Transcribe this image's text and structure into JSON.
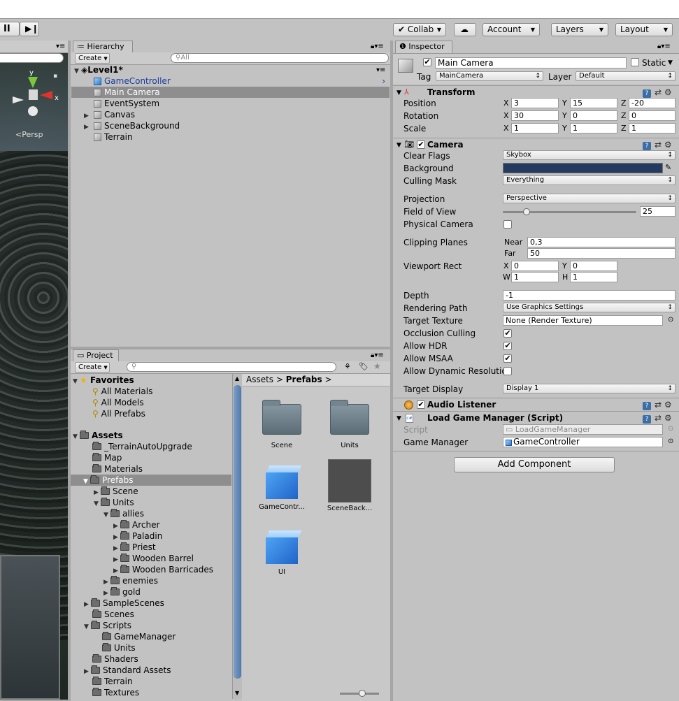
{
  "toolbar": {
    "collab": "Collab",
    "account": "Account",
    "layers": "Layers",
    "layout": "Layout"
  },
  "scene": {
    "persp_label": "<Persp",
    "gizmo_y": "y",
    "gizmo_x": "x"
  },
  "hierarchy": {
    "tab": "Hierarchy",
    "create": "Create",
    "search_placeholder": "All",
    "scene_name": "Level1*",
    "items": [
      {
        "label": "GameController"
      },
      {
        "label": "Main Camera"
      },
      {
        "label": "EventSystem"
      },
      {
        "label": "Canvas"
      },
      {
        "label": "SceneBackground"
      },
      {
        "label": "Terrain"
      }
    ]
  },
  "project": {
    "tab": "Project",
    "create": "Create",
    "favorites": {
      "label": "Favorites",
      "items": [
        "All Materials",
        "All Models",
        "All Prefabs"
      ]
    },
    "assets_label": "Assets",
    "tree": [
      "_TerrainAutoUpgrade",
      "Map",
      "Materials",
      "Prefabs",
      "Scene",
      "Units",
      "allies",
      "Archer",
      "Paladin",
      "Priest",
      "Wooden Barrel",
      "Wooden Barricades",
      "enemies",
      "gold",
      "SampleScenes",
      "Scenes",
      "Scripts",
      "GameManager",
      "Units",
      "Shaders",
      "Standard Assets",
      "Terrain",
      "Textures"
    ],
    "breadcrumb": [
      "Assets",
      "Prefabs"
    ],
    "grid": [
      "Scene",
      "Units",
      "GameContr...",
      "SceneBack...",
      "UI"
    ]
  },
  "inspector": {
    "tab": "Inspector",
    "object_name": "Main Camera",
    "static_label": "Static",
    "tag_label": "Tag",
    "tag_value": "MainCamera",
    "layer_label": "Layer",
    "layer_value": "Default",
    "transform": {
      "title": "Transform",
      "position_label": "Position",
      "rotation_label": "Rotation",
      "scale_label": "Scale",
      "position": {
        "x": "3",
        "y": "15",
        "z": "-20"
      },
      "rotation": {
        "x": "30",
        "y": "0",
        "z": "0"
      },
      "scale": {
        "x": "1",
        "y": "1",
        "z": "1"
      }
    },
    "camera": {
      "title": "Camera",
      "clear_flags_label": "Clear Flags",
      "clear_flags": "Skybox",
      "background_label": "Background",
      "background_color": "#243a5e",
      "culling_mask_label": "Culling Mask",
      "culling_mask": "Everything",
      "projection_label": "Projection",
      "projection": "Perspective",
      "fov_label": "Field of View",
      "fov": "25",
      "fov_fraction": 0.16,
      "physical_label": "Physical Camera",
      "clipping_label": "Clipping Planes",
      "near_label": "Near",
      "near": "0,3",
      "far_label": "Far",
      "far": "50",
      "viewport_label": "Viewport Rect",
      "vx": "0",
      "vy": "0",
      "vw": "1",
      "vh": "1",
      "depth_label": "Depth",
      "depth": "-1",
      "rendering_path_label": "Rendering Path",
      "rendering_path": "Use Graphics Settings",
      "target_texture_label": "Target Texture",
      "target_texture": "None (Render Texture)",
      "occlusion_label": "Occlusion Culling",
      "hdr_label": "Allow HDR",
      "msaa_label": "Allow MSAA",
      "dynres_label": "Allow Dynamic Resolutio",
      "target_display_label": "Target Display",
      "target_display": "Display 1"
    },
    "audio": {
      "title": "Audio Listener"
    },
    "script_comp": {
      "title": "Load Game Manager (Script)",
      "script_label": "Script",
      "script_value": "LoadGameManager",
      "gm_label": "Game Manager",
      "gm_value": "GameController"
    },
    "add_component": "Add Component"
  },
  "axis": {
    "x": "X",
    "y": "Y",
    "z": "Z",
    "w": "W",
    "h": "H"
  }
}
